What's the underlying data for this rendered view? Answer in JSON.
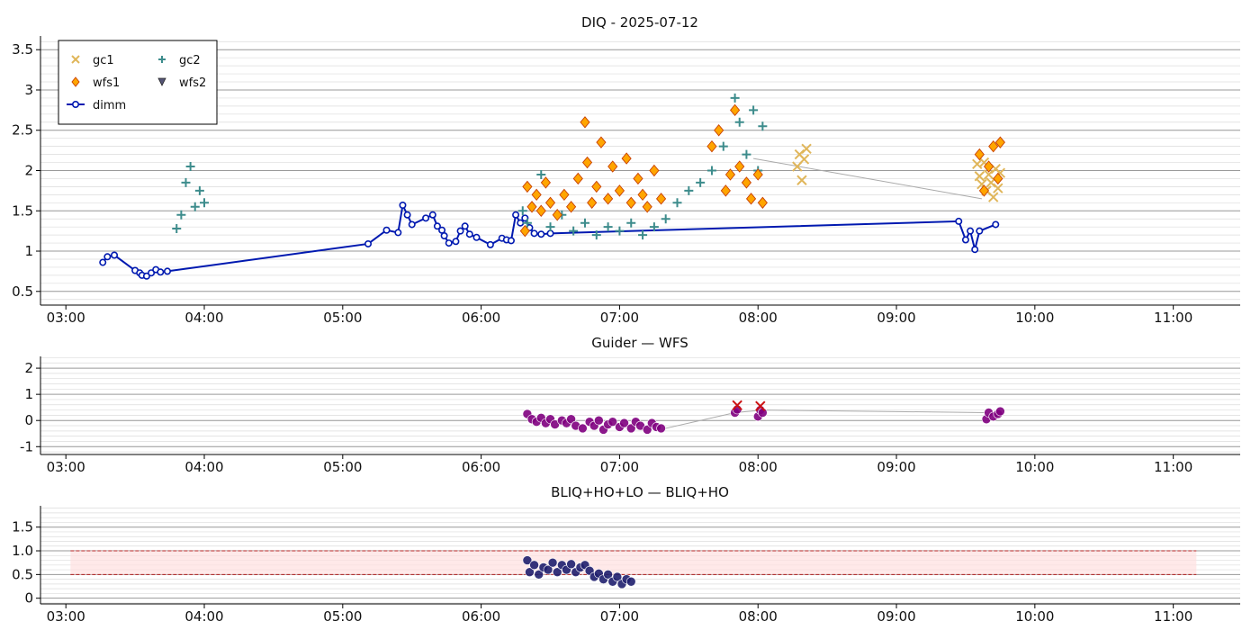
{
  "chart_data": [
    {
      "type": "scatter",
      "title": "DIQ - 2025-07-12",
      "xlabel": "",
      "ylabel": "",
      "x_ticks": [
        "03:00",
        "04:00",
        "05:00",
        "06:00",
        "07:00",
        "08:00",
        "09:00",
        "10:00",
        "11:00"
      ],
      "y_ticks": [
        "0.5",
        "1",
        "1.5",
        "2",
        "2.5",
        "3",
        "3.5"
      ],
      "xlim": [
        "02:49",
        "11:29"
      ],
      "ylim": [
        0.33,
        3.67
      ],
      "grid": "horizontal, major and minor",
      "legend": {
        "placement": "top-left",
        "entries": [
          {
            "label": "gc1",
            "marker": "x",
            "color": "#e0b65a"
          },
          {
            "label": "gc2",
            "marker": "+",
            "color": "#3d8c8c"
          },
          {
            "label": "wfs1",
            "marker": "diamond",
            "color": "#ffa500"
          },
          {
            "label": "wfs2",
            "marker": "triangle-down",
            "color": "#555577"
          },
          {
            "label": "dimm",
            "marker": "circle-line",
            "color": "#0019b0"
          }
        ]
      },
      "series": [
        {
          "name": "dimm",
          "type": "line",
          "color": "#0019b0",
          "x": [
            "03:16",
            "03:18",
            "03:21",
            "03:30",
            "03:32",
            "03:33",
            "03:35",
            "03:37",
            "03:39",
            "03:41",
            "03:44",
            "05:11",
            "05:19",
            "05:24",
            "05:26",
            "05:28",
            "05:30",
            "05:36",
            "05:39",
            "05:41",
            "05:43",
            "05:44",
            "05:46",
            "05:49",
            "05:51",
            "05:53",
            "05:55",
            "05:58",
            "06:04",
            "06:09",
            "06:11",
            "06:13",
            "06:15",
            "06:17",
            "06:19",
            "06:21",
            "06:23",
            "06:26",
            "06:30",
            "09:27",
            "09:30",
            "09:32",
            "09:34",
            "09:36",
            "09:43"
          ],
          "y": [
            0.86,
            0.93,
            0.95,
            0.76,
            0.73,
            0.7,
            0.69,
            0.73,
            0.77,
            0.74,
            0.75,
            1.09,
            1.26,
            1.23,
            1.57,
            1.45,
            1.33,
            1.41,
            1.45,
            1.31,
            1.26,
            1.19,
            1.1,
            1.12,
            1.25,
            1.31,
            1.21,
            1.17,
            1.08,
            1.16,
            1.14,
            1.13,
            1.45,
            1.35,
            1.41,
            1.29,
            1.22,
            1.21,
            1.22,
            1.37,
            1.14,
            1.25,
            1.02,
            1.25,
            1.33
          ]
        },
        {
          "name": "gc1",
          "type": "scatter",
          "marker": "x",
          "color": "#e0b65a",
          "x": [
            "08:17",
            "08:18",
            "08:19",
            "08:20",
            "08:21",
            "09:35",
            "09:36",
            "09:37",
            "09:38",
            "09:39",
            "09:40",
            "09:41",
            "09:42",
            "09:43",
            "09:44",
            "09:45"
          ],
          "y": [
            2.05,
            2.2,
            1.88,
            2.14,
            2.27,
            2.08,
            1.93,
            1.83,
            2.1,
            1.75,
            1.95,
            1.85,
            1.67,
            2.02,
            1.78,
            1.97
          ]
        },
        {
          "name": "gc2",
          "type": "scatter",
          "marker": "+",
          "color": "#3d8c8c",
          "x": [
            "03:48",
            "03:50",
            "03:52",
            "03:54",
            "03:56",
            "03:58",
            "04:00",
            "06:18",
            "06:20",
            "06:26",
            "06:30",
            "06:35",
            "06:40",
            "06:45",
            "06:50",
            "06:55",
            "07:00",
            "07:05",
            "07:10",
            "07:15",
            "07:20",
            "07:25",
            "07:30",
            "07:35",
            "07:40",
            "07:45",
            "07:50",
            "07:52",
            "07:55",
            "07:58",
            "08:00",
            "08:02"
          ],
          "y": [
            1.28,
            1.45,
            1.85,
            2.05,
            1.55,
            1.75,
            1.6,
            1.5,
            1.35,
            1.95,
            1.3,
            1.45,
            1.25,
            1.35,
            1.2,
            1.3,
            1.25,
            1.35,
            1.2,
            1.3,
            1.4,
            1.6,
            1.75,
            1.85,
            2.0,
            2.3,
            2.9,
            2.6,
            2.2,
            2.75,
            2.0,
            2.55
          ]
        },
        {
          "name": "wfs1",
          "type": "scatter",
          "marker": "diamond",
          "color": "#ffa500",
          "x": [
            "06:19",
            "06:20",
            "06:22",
            "06:24",
            "06:26",
            "06:28",
            "06:30",
            "06:33",
            "06:36",
            "06:39",
            "06:42",
            "06:45",
            "06:46",
            "06:48",
            "06:50",
            "06:52",
            "06:55",
            "06:57",
            "07:00",
            "07:03",
            "07:05",
            "07:08",
            "07:10",
            "07:12",
            "07:15",
            "07:18",
            "07:40",
            "07:43",
            "07:46",
            "07:48",
            "07:50",
            "07:52",
            "07:55",
            "07:57",
            "08:00",
            "08:02",
            "09:36",
            "09:38",
            "09:40",
            "09:42",
            "09:44",
            "09:45"
          ],
          "y": [
            1.25,
            1.8,
            1.55,
            1.7,
            1.5,
            1.85,
            1.6,
            1.45,
            1.7,
            1.55,
            1.9,
            2.6,
            2.1,
            1.6,
            1.8,
            2.35,
            1.65,
            2.05,
            1.75,
            2.15,
            1.6,
            1.9,
            1.7,
            1.55,
            2.0,
            1.65,
            2.3,
            2.5,
            1.75,
            1.95,
            2.75,
            2.05,
            1.85,
            1.65,
            1.95,
            1.6,
            2.2,
            1.75,
            2.05,
            2.3,
            1.9,
            2.35
          ]
        }
      ],
      "gray_connector": {
        "x": [
          "07:58",
          "09:37"
        ],
        "y": [
          2.15,
          1.65
        ]
      }
    },
    {
      "type": "scatter",
      "title": "Guider — WFS",
      "xlabel": "",
      "ylabel": "",
      "x_ticks": [
        "03:00",
        "04:00",
        "05:00",
        "06:00",
        "07:00",
        "08:00",
        "09:00",
        "10:00",
        "11:00"
      ],
      "y_ticks": [
        "-1",
        "0",
        "1",
        "2"
      ],
      "xlim": [
        "02:49",
        "11:29"
      ],
      "ylim": [
        -1.3,
        2.45
      ],
      "grid": "horizontal, major and minor",
      "series": [
        {
          "name": "",
          "type": "scatter",
          "marker": "circle",
          "color": "#800080",
          "x": [
            "06:20",
            "06:22",
            "06:24",
            "06:26",
            "06:28",
            "06:30",
            "06:32",
            "06:35",
            "06:37",
            "06:39",
            "06:41",
            "06:44",
            "06:47",
            "06:49",
            "06:51",
            "06:53",
            "06:55",
            "06:57",
            "07:00",
            "07:02",
            "07:05",
            "07:07",
            "07:09",
            "07:12",
            "07:14",
            "07:16",
            "07:18",
            "07:50",
            "07:51",
            "08:00",
            "08:01",
            "08:02",
            "09:39",
            "09:40",
            "09:42",
            "09:44",
            "09:45"
          ],
          "y": [
            0.25,
            0.05,
            -0.05,
            0.1,
            -0.1,
            0.05,
            -0.15,
            0.0,
            -0.1,
            0.05,
            -0.2,
            -0.3,
            -0.05,
            -0.2,
            0.0,
            -0.35,
            -0.15,
            -0.05,
            -0.25,
            -0.1,
            -0.3,
            -0.05,
            -0.2,
            -0.35,
            -0.1,
            -0.25,
            -0.3,
            0.3,
            0.42,
            0.15,
            0.4,
            0.3,
            0.05,
            0.3,
            0.15,
            0.25,
            0.35
          ]
        },
        {
          "name": "",
          "type": "scatter",
          "marker": "x",
          "color": "#cc1111",
          "x": [
            "07:51",
            "08:01"
          ],
          "y": [
            0.58,
            0.55
          ]
        }
      ],
      "gray_connector": {
        "x": [
          "07:20",
          "07:50",
          "08:02",
          "09:39"
        ],
        "y": [
          -0.3,
          0.3,
          0.4,
          0.3
        ]
      }
    },
    {
      "type": "scatter",
      "title": "BLIQ+HO+LO — BLIQ+HO",
      "xlabel": "",
      "ylabel": "",
      "x_ticks": [
        "03:00",
        "04:00",
        "05:00",
        "06:00",
        "07:00",
        "08:00",
        "09:00",
        "10:00",
        "11:00"
      ],
      "y_ticks": [
        "0",
        "0.5",
        "1.0",
        "1.5"
      ],
      "xlim": [
        "02:49",
        "11:29"
      ],
      "ylim": [
        -0.12,
        1.95
      ],
      "grid": "horizontal, major and minor",
      "band": {
        "x": [
          "03:02",
          "11:10"
        ],
        "y": [
          0.5,
          1.0
        ],
        "color": "#ffe0e0",
        "edge_color": "#b22222"
      },
      "series": [
        {
          "name": "",
          "type": "scatter",
          "marker": "circle",
          "color": "#1f1f6e",
          "x": [
            "06:20",
            "06:21",
            "06:23",
            "06:25",
            "06:27",
            "06:29",
            "06:31",
            "06:33",
            "06:35",
            "06:37",
            "06:39",
            "06:41",
            "06:43",
            "06:45",
            "06:47",
            "06:49",
            "06:51",
            "06:53",
            "06:55",
            "06:57",
            "06:59",
            "07:01",
            "07:03",
            "07:05"
          ],
          "y": [
            0.8,
            0.55,
            0.7,
            0.5,
            0.65,
            0.6,
            0.75,
            0.55,
            0.7,
            0.6,
            0.72,
            0.55,
            0.65,
            0.7,
            0.58,
            0.45,
            0.52,
            0.4,
            0.5,
            0.35,
            0.45,
            0.3,
            0.4,
            0.35
          ]
        }
      ]
    }
  ]
}
